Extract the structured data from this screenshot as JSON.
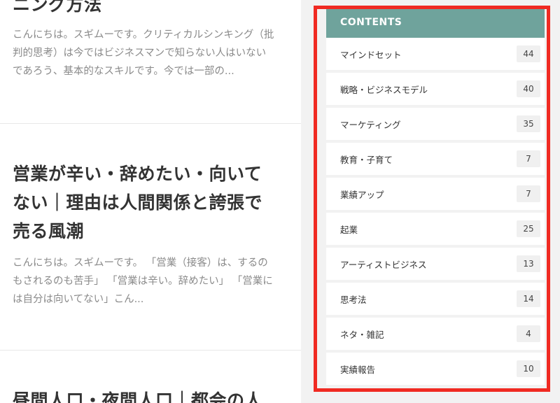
{
  "posts": [
    {
      "title": "ニング方法",
      "excerpt": "こんにちは。スギムーです。クリティカルシンキング（批判的思考）は今ではビジネスマンで知らない人はいないであろう、基本的なスキルです。今では一部の..."
    },
    {
      "title": "営業が辛い・辞めたい・向いてない｜理由は人間関係と誇張で売る風潮",
      "excerpt": "こんにちは。スギムーです。 「営業（接客）は、するのもされるのも苦手」 「営業は辛い。辞めたい」 「営業には自分は向いてない」こん..."
    },
    {
      "title": "昼間人口・夜間人口｜都会の人"
    }
  ],
  "sidebar": {
    "header": "CONTENTS",
    "categories": [
      {
        "label": "マインドセット",
        "count": "44"
      },
      {
        "label": "戦略・ビジネスモデル",
        "count": "40"
      },
      {
        "label": "マーケティング",
        "count": "35"
      },
      {
        "label": "教育・子育て",
        "count": "7"
      },
      {
        "label": "業績アップ",
        "count": "7"
      },
      {
        "label": "起業",
        "count": "25"
      },
      {
        "label": "アーティストビジネス",
        "count": "13"
      },
      {
        "label": "思考法",
        "count": "14"
      },
      {
        "label": "ネタ・雑記",
        "count": "4"
      },
      {
        "label": "実績報告",
        "count": "10"
      }
    ]
  },
  "colors": {
    "header_bg": "#6fa39c",
    "highlight_border": "#f02a22",
    "sidebar_bg": "#f2f2f2"
  }
}
